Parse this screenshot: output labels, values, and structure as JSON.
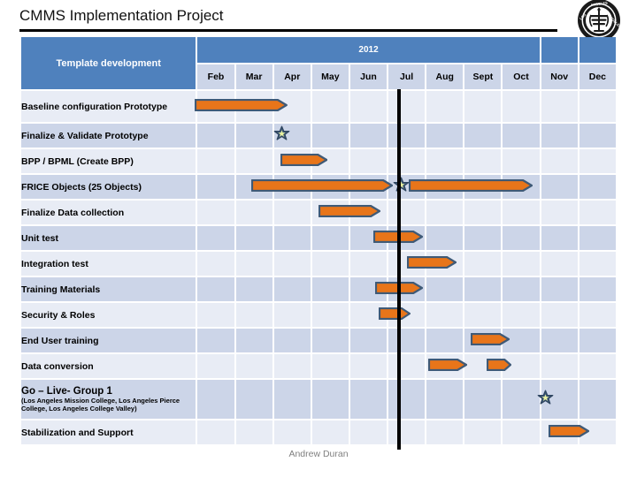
{
  "slide": {
    "title": "CMMS Implementation Project",
    "footer": "Andrew Duran",
    "logo_name": "los-angeles-college-seal"
  },
  "chart_data": {
    "type": "gantt",
    "title": "CMMS Implementation Project",
    "year": "2012",
    "task_column_header": "Template development",
    "categories": [
      "Feb",
      "Mar",
      "Apr",
      "May",
      "Jun",
      "Jul",
      "Aug",
      "Sept",
      "Oct",
      "Nov",
      "Dec"
    ],
    "colors": {
      "header_blue": "#4f81bd",
      "row_light": "#e8ecf5",
      "row_dark": "#ccd5e8",
      "bar_fill": "#e8751a",
      "bar_outline": "#3f5a77",
      "today_line": "#000000"
    },
    "today_marker_month": "Jul",
    "tasks": [
      {
        "label": "Baseline configuration Prototype",
        "bars": [
          {
            "start_month": "Feb",
            "end_month": "Apr",
            "start_frac": 0.1,
            "end_frac": 0.62
          }
        ],
        "milestones": []
      },
      {
        "label": "Finalize & Validate Prototype",
        "bars": [],
        "milestones": [
          {
            "month": "Apr",
            "frac": 0.45
          }
        ]
      },
      {
        "label": "BPP / BPML (Create BPP)",
        "bars": [
          {
            "start_month": "Apr",
            "end_month": "May",
            "start_frac": 0.42,
            "end_frac": 0.7
          }
        ],
        "milestones": []
      },
      {
        "label": "FRICE Objects (25 Objects)",
        "bars": [
          {
            "start_month": "Mar",
            "end_month": "Jul",
            "start_frac": 0.65,
            "end_frac": 0.45
          },
          {
            "start_month": "Jul",
            "end_month": "Nov",
            "start_frac": 0.9,
            "end_frac": 0.2
          }
        ],
        "milestones": [
          {
            "month": "Jul",
            "frac": 0.68
          }
        ]
      },
      {
        "label": "Finalize Data collection",
        "bars": [
          {
            "start_month": "May",
            "end_month": "Jul",
            "start_frac": 0.45,
            "end_frac": 0.1
          }
        ],
        "milestones": []
      },
      {
        "label": "Unit test",
        "bars": [
          {
            "start_month": "Jun",
            "end_month": "Aug",
            "start_frac": 0.95,
            "end_frac": 0.25
          }
        ],
        "milestones": []
      },
      {
        "label": "Integration test",
        "bars": [
          {
            "start_month": "Jul",
            "end_month": "Sept",
            "start_frac": 0.85,
            "end_frac": 0.15
          }
        ],
        "milestones": []
      },
      {
        "label": "Training Materials",
        "bars": [
          {
            "start_month": "Jun",
            "end_month": "Aug",
            "start_frac": 1.0,
            "end_frac": 0.25
          }
        ],
        "milestones": []
      },
      {
        "label": "Security & Roles",
        "bars": [
          {
            "start_month": "Jul",
            "end_month": "Jul",
            "start_frac": 0.05,
            "end_frac": 0.95
          }
        ],
        "milestones": []
      },
      {
        "label": "End User training",
        "bars": [
          {
            "start_month": "Sept",
            "end_month": "Oct",
            "start_frac": 0.55,
            "end_frac": 0.6
          }
        ],
        "milestones": []
      },
      {
        "label": "Data conversion",
        "bars": [
          {
            "start_month": "Aug",
            "end_month": "Sept",
            "start_frac": 0.4,
            "end_frac": 0.45
          },
          {
            "start_month": "Sept",
            "end_month": "Oct",
            "start_frac": 1.0,
            "end_frac": 0.65
          }
        ],
        "milestones": []
      },
      {
        "label": "Go – Live- Group 1",
        "label_sub": "(Los Angeles Mission College, Los Angeles Pierce College, Los Angeles  College Valley)",
        "bars": [],
        "milestones": [
          {
            "month": "Nov",
            "frac": 0.55
          }
        ]
      },
      {
        "label": "Stabilization and Support",
        "bars": [
          {
            "start_month": "Nov",
            "end_month": "Dec",
            "start_frac": 0.65,
            "end_frac": 0.75
          }
        ],
        "milestones": []
      }
    ]
  }
}
